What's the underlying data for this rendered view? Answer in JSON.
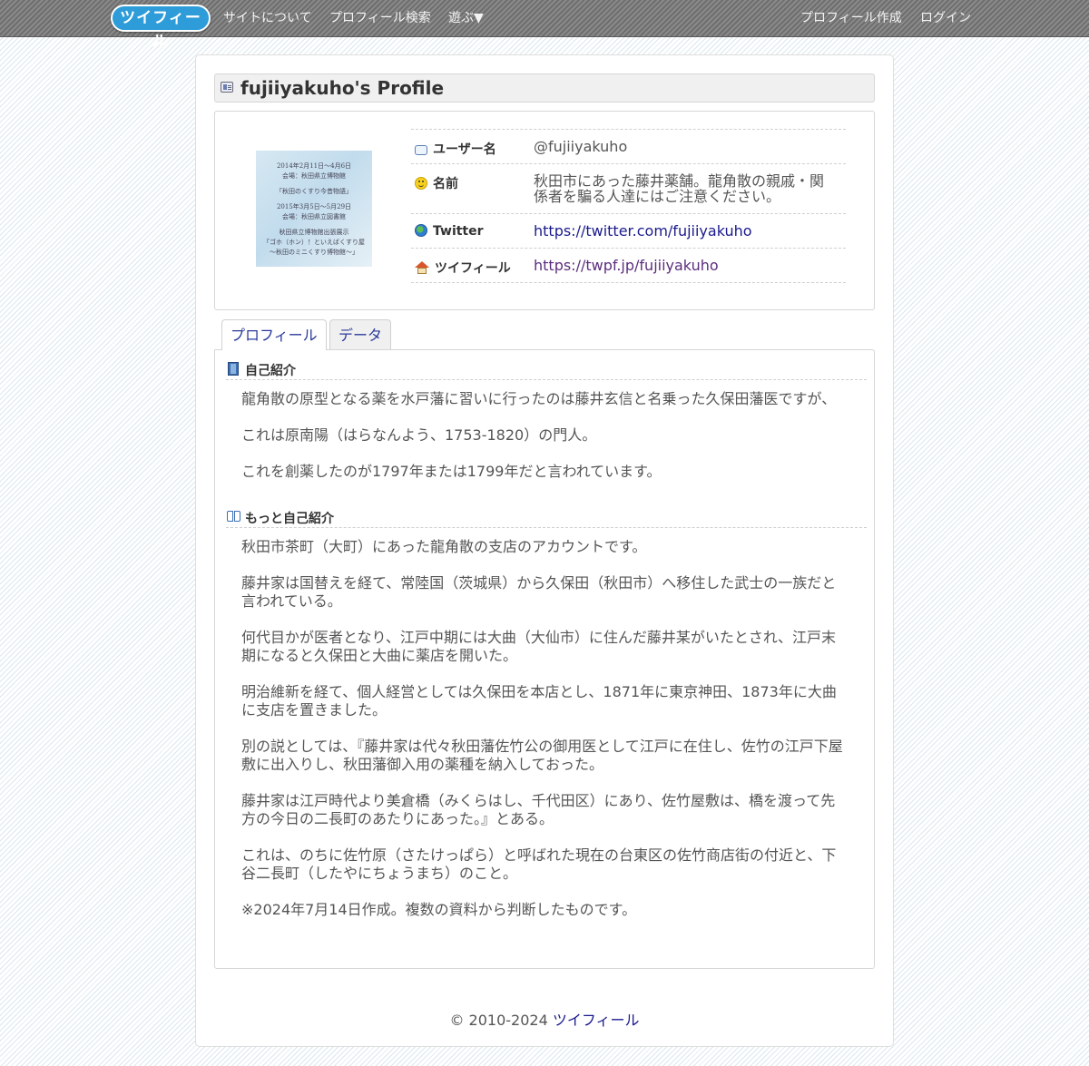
{
  "nav": {
    "logo": "ツイフィール",
    "items": [
      "サイトについて",
      "プロフィール検索",
      "遊ぶ▼"
    ],
    "right": [
      "プロフィール作成",
      "ログイン"
    ]
  },
  "page": {
    "title": "fujiiyakuho's Profile"
  },
  "avatar_text": {
    "lines": [
      "2014年2月11日〜4月6日",
      "会場：秋田県立博物館",
      "「秋田のくすり今昔物語」",
      "2015年3月5日〜5月29日",
      "会場：秋田県立図書館",
      "秋田県立博物館出張展示",
      "「ゴホ（ホン）！といえばくすり屋",
      "〜秋田のミニくすり博物館〜」"
    ]
  },
  "profile": {
    "username_label": "ユーザー名",
    "username": "@fujiiyakuho",
    "name_label": "名前",
    "name": "秋田市にあった藤井薬舗。龍角散の親戚・関係者を騙る人達にはご注意ください。",
    "twitter_label": "Twitter",
    "twitter_url": "https://twitter.com/fujiiyakuho",
    "twpf_label": "ツイフィール",
    "twpf_url": "https://twpf.jp/fujiiyakuho"
  },
  "tabs": [
    "プロフィール",
    "データ"
  ],
  "intro": {
    "heading": "自己紹介",
    "paragraphs": [
      "龍角散の原型となる薬を水戸藩に習いに行ったのは藤井玄信と名乗った久保田藩医ですが、",
      "これは原南陽（はらなんよう、1753-1820）の門人。",
      "これを創薬したのが1797年または1799年だと言われています。"
    ]
  },
  "more": {
    "heading": "もっと自己紹介",
    "paragraphs": [
      "秋田市茶町（大町）にあった龍角散の支店のアカウントです。",
      "藤井家は国替えを経て、常陸国（茨城県）から久保田（秋田市）へ移住した武士の一族だと言われている。",
      "何代目かが医者となり、江戸中期には大曲（大仙市）に住んだ藤井某がいたとされ、江戸末期になると久保田と大曲に薬店を開いた。",
      "明治維新を経て、個人経営としては久保田を本店とし、1871年に東京神田、1873年に大曲に支店を置きました。",
      "別の説としては、『藤井家は代々秋田藩佐竹公の御用医として江戸に在住し、佐竹の江戸下屋敷に出入りし、秋田藩御入用の薬種を納入しておった。",
      "藤井家は江戸時代より美倉橋（みくらはし、千代田区）にあり、佐竹屋敷は、橋を渡って先方の今日の二長町のあたりにあった。』とある。",
      "これは、のちに佐竹原（さたけっぱら）と呼ばれた現在の台東区の佐竹商店街の付近と、下谷二長町（したやにちょうまち）のこと。",
      "※2024年7月14日作成。複数の資料から判断したものです。"
    ]
  },
  "footer": {
    "copyright": "© 2010-2024 ",
    "site_link": "ツイフィール"
  }
}
